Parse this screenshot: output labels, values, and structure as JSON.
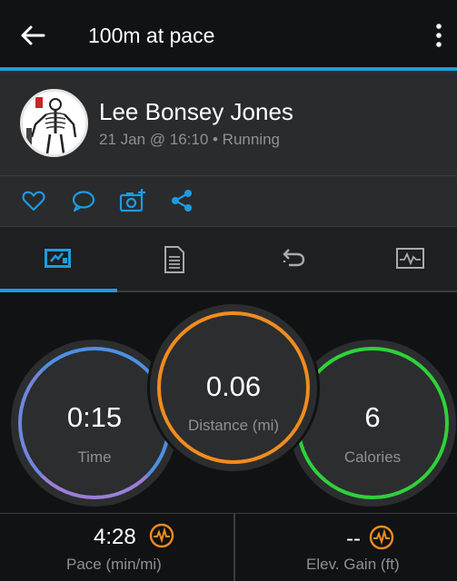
{
  "header": {
    "title": "100m at pace",
    "accent_color": "#1e9be0"
  },
  "profile": {
    "name": "Lee Bonsey Jones",
    "meta": "21 Jan @ 16:10 • Running"
  },
  "actions": {
    "icons": [
      "heart-icon",
      "comment-icon",
      "add-photo-icon",
      "share-icon"
    ]
  },
  "tabs": {
    "items": [
      "summary-tab",
      "details-tab",
      "laps-tab",
      "charts-tab"
    ],
    "active_index": 0
  },
  "stats": {
    "time": {
      "value": "0:15",
      "label": "Time",
      "ring_color": "#4f8fe0"
    },
    "distance": {
      "value": "0.06",
      "label": "Distance (mi)",
      "ring_color": "#f08c1e"
    },
    "calories": {
      "value": "6",
      "label": "Calories",
      "ring_color": "#2ed13a"
    }
  },
  "bottom": {
    "pace": {
      "value": "4:28",
      "label": "Pace (min/mi)"
    },
    "elevation": {
      "value": "--",
      "label": "Elev. Gain (ft)"
    }
  }
}
